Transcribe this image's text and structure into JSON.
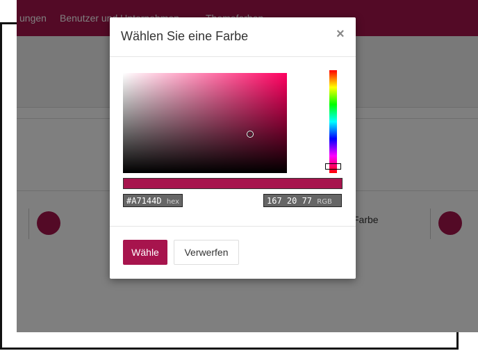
{
  "background": {
    "nav": [
      "ungen",
      "Benutzer und Unternehmen",
      "Themefarben"
    ],
    "partial_label": "Farbe",
    "accent_color": "#A7144D"
  },
  "dialog": {
    "title": "Wählen Sie eine Farbe",
    "close_symbol": "×",
    "selected_color": "#A7144D",
    "hex_value": "#A7144D",
    "hex_suffix": "hex",
    "rgb_value": "167 20 77",
    "rgb_suffix": "RGB",
    "choose_label": "Wähle",
    "discard_label": "Verwerfen"
  }
}
